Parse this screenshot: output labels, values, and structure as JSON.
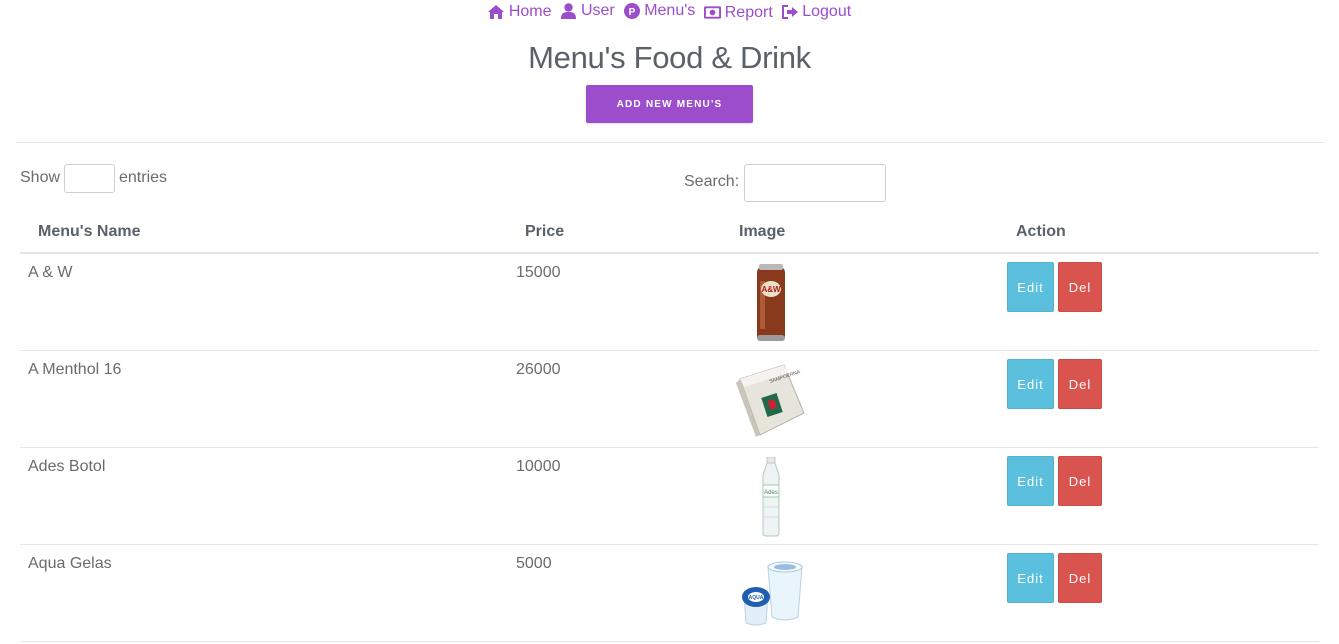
{
  "nav": {
    "home": "Home",
    "user": "User",
    "menus": "Menu's",
    "report": "Report",
    "logout": "Logout"
  },
  "page": {
    "title": "Menu's Food & Drink",
    "add_button": "ADD NEW MENU'S"
  },
  "table_controls": {
    "show_label": "Show",
    "show_value": "",
    "entries_label": "entries",
    "search_label": "Search:",
    "search_value": ""
  },
  "table": {
    "headers": [
      "Menu's Name",
      "Price",
      "Image",
      "Action"
    ],
    "rows": [
      {
        "name": "A & W",
        "price": "15000",
        "image": "can-drink-image",
        "edit": "Edit",
        "del": "Del"
      },
      {
        "name": "A Menthol 16",
        "price": "26000",
        "image": "cigarette-pack-image",
        "edit": "Edit",
        "del": "Del"
      },
      {
        "name": "Ades Botol",
        "price": "10000",
        "image": "water-bottle-image",
        "edit": "Edit",
        "del": "Del"
      },
      {
        "name": "Aqua Gelas",
        "price": "5000",
        "image": "water-cup-image",
        "edit": "Edit",
        "del": "Del"
      }
    ]
  },
  "colors": {
    "accent": "#9c4dcc",
    "edit": "#5bc0de",
    "delete": "#d9534f"
  }
}
